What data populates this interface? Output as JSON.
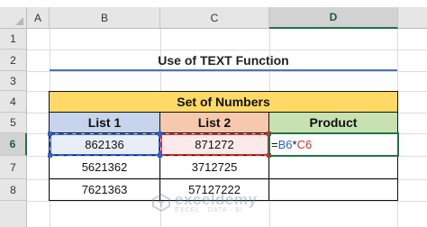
{
  "columns": [
    "A",
    "B",
    "C",
    "D"
  ],
  "rows": [
    "1",
    "2",
    "3",
    "4",
    "5",
    "6",
    "7",
    "8"
  ],
  "title": "Use of TEXT Function",
  "table": {
    "header": "Set of Numbers",
    "col_headers": [
      "List 1",
      "List 2",
      "Product"
    ],
    "list1": [
      "862136",
      "5621362",
      "7621363"
    ],
    "list2": [
      "871272",
      "3712725",
      "57127222"
    ]
  },
  "formula": {
    "eq": "=",
    "ref1": "B6",
    "op": "*",
    "ref2": "C6"
  },
  "colors": {
    "header_fill": "#ffd966",
    "list1_fill": "#c6d4ec",
    "list2_fill": "#f6c9ae",
    "product_fill": "#c7e1b0",
    "ref1_color": "#2f5fd0",
    "ref2_color": "#d02f2f",
    "active_border": "#217346"
  },
  "watermark": {
    "name": "exceldemy",
    "tagline": "EXCEL · DATA · BI"
  }
}
